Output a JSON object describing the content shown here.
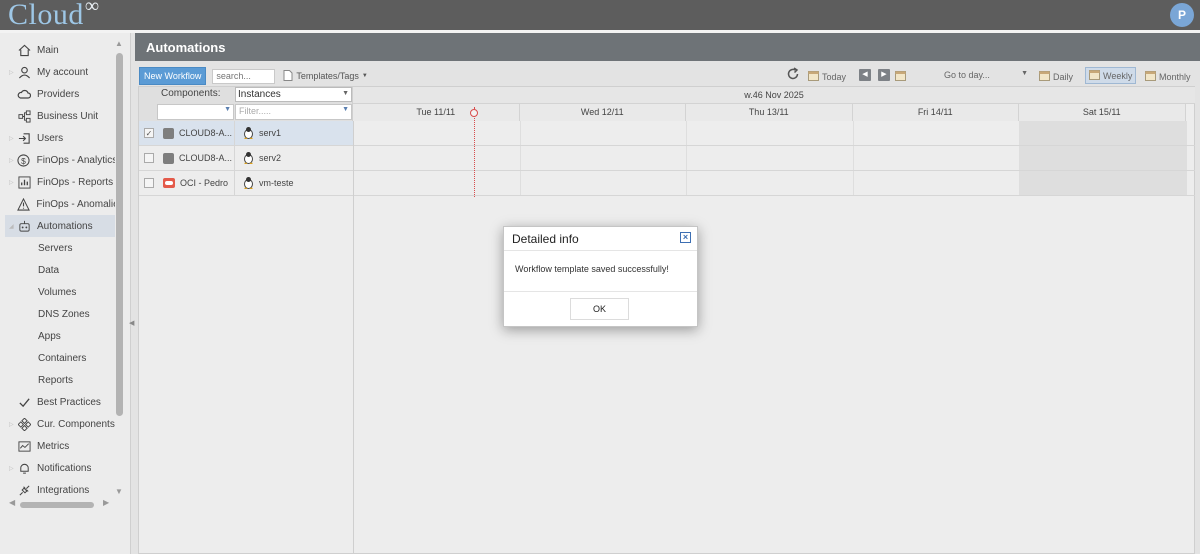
{
  "app": {
    "logo_text": "Cloud",
    "logo_symbol": "∞",
    "user_initial": "P"
  },
  "sidebar": {
    "items": [
      {
        "label": "Main",
        "icon": "home-icon"
      },
      {
        "label": "My account",
        "icon": "user-icon"
      },
      {
        "label": "Providers",
        "icon": "cloud-icon"
      },
      {
        "label": "Business Unit",
        "icon": "business-unit-icon"
      },
      {
        "label": "Users",
        "icon": "users-icon"
      },
      {
        "label": "FinOps - Analytics",
        "icon": "dollar-icon"
      },
      {
        "label": "FinOps - Reports",
        "icon": "report-icon"
      },
      {
        "label": "FinOps - Anomalie",
        "icon": "warning-icon"
      },
      {
        "label": "Automations",
        "icon": "robot-icon"
      }
    ],
    "sub_items": [
      "Servers",
      "Data",
      "Volumes",
      "DNS Zones",
      "Apps",
      "Containers",
      "Reports"
    ],
    "bottom_items": [
      {
        "label": "Best Practices",
        "icon": "check-icon"
      },
      {
        "label": "Cur. Components",
        "icon": "components-icon"
      },
      {
        "label": "Metrics",
        "icon": "metrics-icon"
      },
      {
        "label": "Notifications",
        "icon": "bell-icon"
      },
      {
        "label": "Integrations",
        "icon": "plug-icon"
      }
    ]
  },
  "page": {
    "title": "Automations"
  },
  "toolbar": {
    "new_workflow": "New Workflow",
    "search_placeholder": "search...",
    "templates": "Templates/Tags",
    "today": "Today",
    "goto": "Go to day...",
    "daily": "Daily",
    "weekly": "Weekly",
    "monthly": "Monthly"
  },
  "grid": {
    "components_label": "Components:",
    "instances_select": "Instances",
    "filter_placeholder": "Filter.....",
    "week_label": "w.46 Nov 2025",
    "days": [
      "Tue 11/11",
      "Wed 12/11",
      "Thu 13/11",
      "Fri 14/11",
      "Sat 15/11"
    ],
    "rows": [
      {
        "component": "CLOUD8-A...",
        "instance": "serv1",
        "checked": true,
        "provider": "aws-icon"
      },
      {
        "component": "CLOUD8-A...",
        "instance": "serv2",
        "checked": false,
        "provider": "aws-icon"
      },
      {
        "component": "OCI - Pedro",
        "instance": "vm-teste",
        "checked": false,
        "provider": "oci-icon"
      }
    ]
  },
  "modal": {
    "title": "Detailed info",
    "message": "Workflow template saved successfully!",
    "ok": "OK"
  }
}
